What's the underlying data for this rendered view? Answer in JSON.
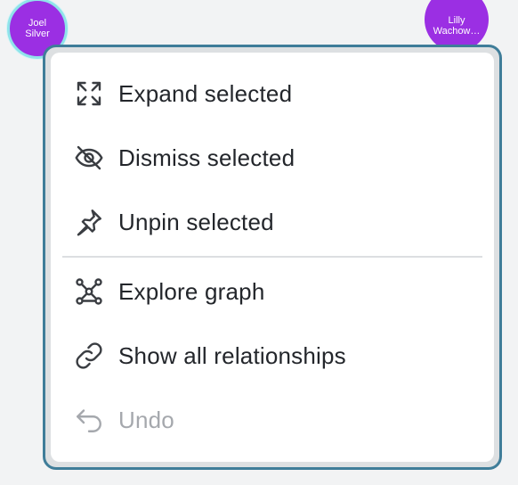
{
  "graph": {
    "nodes": [
      {
        "label": "Joel\nSilver",
        "color": "#9b2fe3"
      },
      {
        "label": "Lilly\nWachow…",
        "color": "#9b2fe3"
      }
    ]
  },
  "context_menu": {
    "border_color": "#3f7d99",
    "groups": [
      [
        {
          "label": "Expand selected",
          "icon": "expand-icon",
          "enabled": true
        },
        {
          "label": "Dismiss selected",
          "icon": "eye-off-icon",
          "enabled": true
        },
        {
          "label": "Unpin selected",
          "icon": "pin-icon",
          "enabled": true
        }
      ],
      [
        {
          "label": "Explore graph",
          "icon": "graph-icon",
          "enabled": true
        },
        {
          "label": "Show all relationships",
          "icon": "link-icon",
          "enabled": true
        },
        {
          "label": "Undo",
          "icon": "undo-icon",
          "enabled": false
        }
      ]
    ]
  }
}
